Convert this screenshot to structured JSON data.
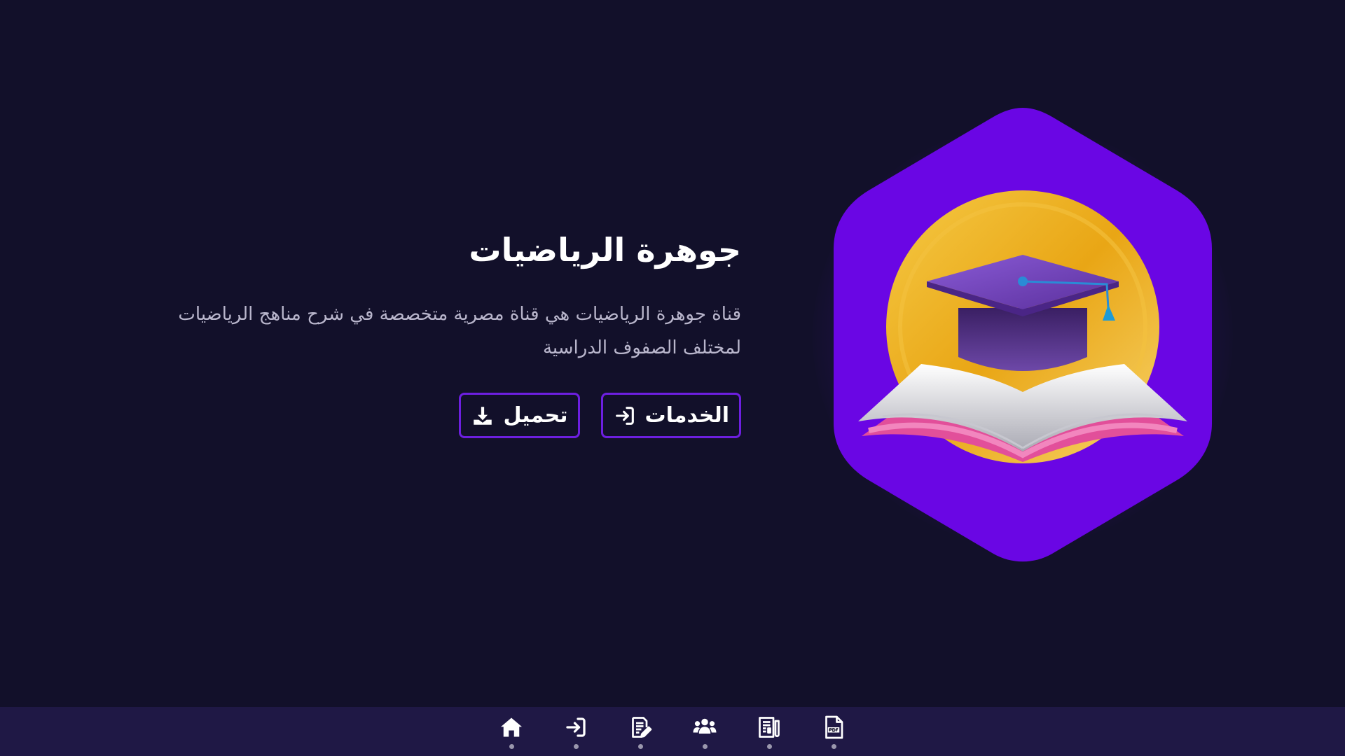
{
  "hero": {
    "title": "جوهرة الرياضيات",
    "description": "قناة جوهرة الرياضيات هي قناة مصرية متخصصة في شرح مناهج الرياضيات لمختلف الصفوف الدراسية",
    "buttons": {
      "services_label": "الخدمات",
      "download_label": "تحميل"
    }
  },
  "bottom_nav": {
    "items": [
      {
        "icon": "home-icon"
      },
      {
        "icon": "sign-in-icon"
      },
      {
        "icon": "edit-document-icon"
      },
      {
        "icon": "users-icon"
      },
      {
        "icon": "newspaper-icon"
      },
      {
        "icon": "pdf-file-icon"
      }
    ]
  },
  "colors": {
    "background": "#12102a",
    "accent": "#6d1fe0",
    "hexagon": "#6a06e4",
    "nav_background": "#1f1845",
    "gold": "#f2b733"
  }
}
